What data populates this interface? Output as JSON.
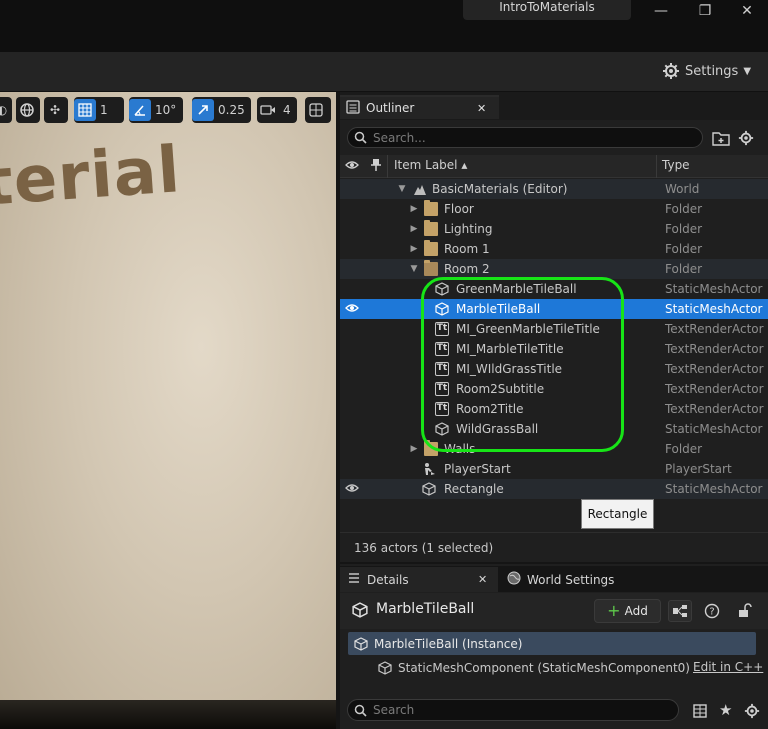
{
  "window": {
    "project_tab": "IntroToMaterials",
    "minimize_glyph": "—",
    "restore_glyph": "❐",
    "close_glyph": "✕"
  },
  "toolbar": {
    "settings_label": "Settings"
  },
  "viewport": {
    "text": "terial",
    "buttons": [
      {
        "icon": "grid-snap-icon",
        "value": "1"
      },
      {
        "icon": "rotation-snap-icon",
        "value": "10°"
      },
      {
        "icon": "scale-snap-icon",
        "value": "0.25"
      },
      {
        "icon": "camera-speed-icon",
        "value": "4"
      }
    ]
  },
  "outliner": {
    "tab_label": "Outliner",
    "search_placeholder": "Search...",
    "col_label": "Item Label ▴",
    "col_type": "Type",
    "rows": [
      {
        "label": "BasicMaterials (Editor)",
        "type": "World"
      },
      {
        "label": "Floor",
        "type": "Folder"
      },
      {
        "label": "Lighting",
        "type": "Folder"
      },
      {
        "label": "Room 1",
        "type": "Folder"
      },
      {
        "label": "Room 2",
        "type": "Folder"
      },
      {
        "label": "GreenMarbleTileBall",
        "type": "StaticMeshActor"
      },
      {
        "label": "MarbleTileBall",
        "type": "StaticMeshActor"
      },
      {
        "label": "MI_GreenMarbleTileTitle",
        "type": "TextRenderActor"
      },
      {
        "label": "MI_MarbleTileTitle",
        "type": "TextRenderActor"
      },
      {
        "label": "MI_WIldGrassTitle",
        "type": "TextRenderActor"
      },
      {
        "label": "Room2Subtitle",
        "type": "TextRenderActor"
      },
      {
        "label": "Room2Title",
        "type": "TextRenderActor"
      },
      {
        "label": "WildGrassBall",
        "type": "StaticMeshActor"
      },
      {
        "label": "Walls",
        "type": "Folder"
      },
      {
        "label": "PlayerStart",
        "type": "PlayerStart"
      },
      {
        "label": "Rectangle",
        "type": "StaticMeshActor"
      }
    ],
    "tooltip": "Rectangle",
    "actor_count": "136 actors (1 selected)"
  },
  "details": {
    "tab_details": "Details",
    "tab_world_settings": "World Settings",
    "selected_name": "MarbleTileBall",
    "add_label": "Add",
    "instance_label": "MarbleTileBall (Instance)",
    "component_label": "StaticMeshComponent (StaticMeshComponent0)",
    "edit_link": "Edit in C++",
    "search_placeholder": "Search"
  },
  "colors": {
    "selection": "#1e78d8",
    "highlight": "#17e417",
    "folder": "#c4a268"
  }
}
